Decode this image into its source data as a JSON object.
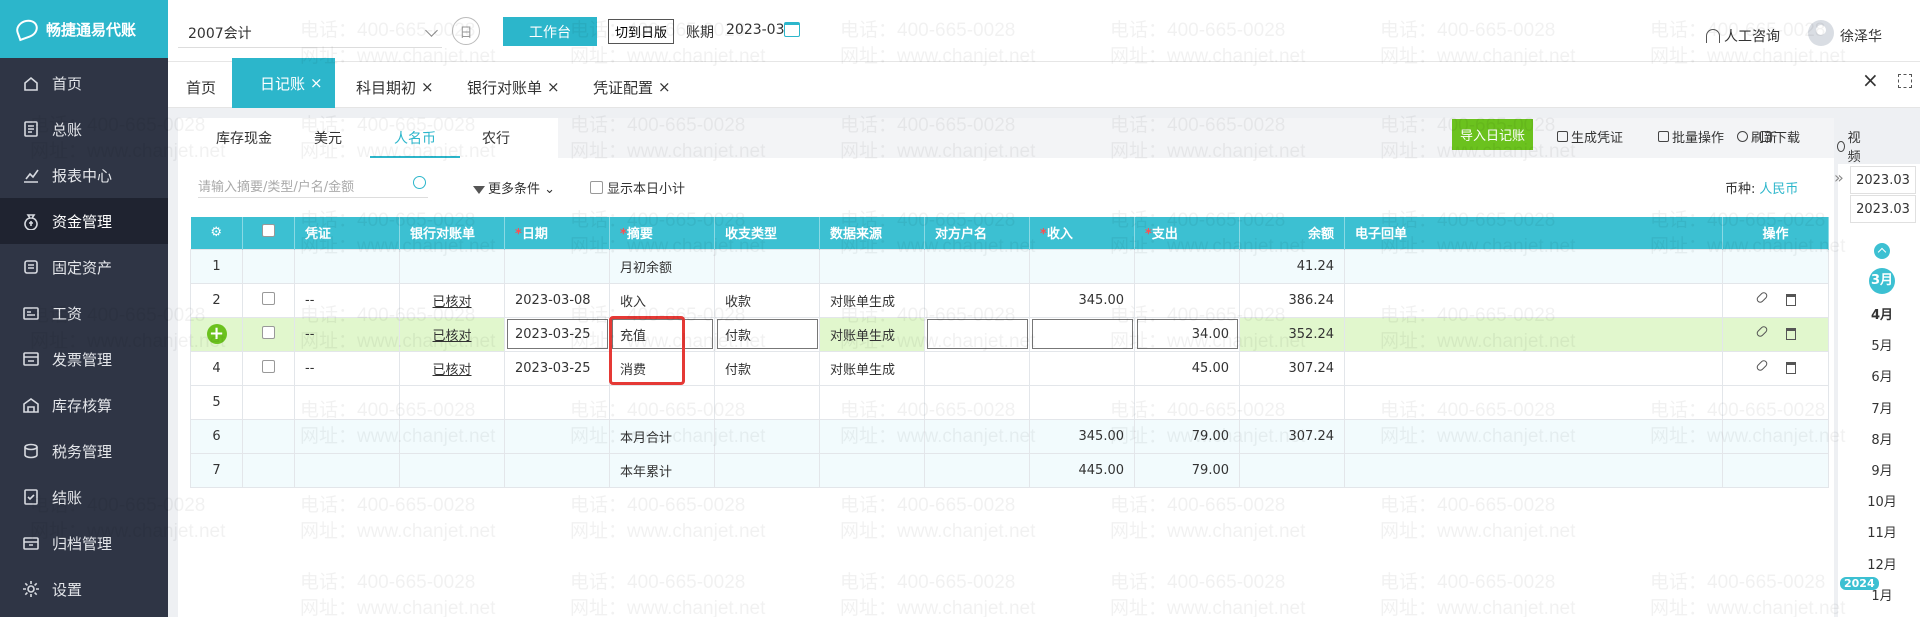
{
  "app": {
    "logo_text": "畅捷通易代账"
  },
  "sidebar": {
    "items": [
      {
        "label": "首页",
        "icon": "home-icon"
      },
      {
        "label": "总账",
        "icon": "ledger-icon"
      },
      {
        "label": "报表中心",
        "icon": "chart-icon"
      },
      {
        "label": "资金管理",
        "icon": "money-bag-icon",
        "active": true
      },
      {
        "label": "固定资产",
        "icon": "asset-icon"
      },
      {
        "label": "工资",
        "icon": "salary-icon"
      },
      {
        "label": "发票管理",
        "icon": "invoice-icon"
      },
      {
        "label": "库存核算",
        "icon": "warehouse-icon"
      },
      {
        "label": "税务管理",
        "icon": "tax-icon"
      },
      {
        "label": "结账",
        "icon": "checkout-icon"
      },
      {
        "label": "归档管理",
        "icon": "archive-icon"
      },
      {
        "label": "设置",
        "icon": "gear-icon"
      }
    ]
  },
  "header": {
    "book": "2007会计",
    "ri_icon_text": "日",
    "workbench": "工作台",
    "switch_journal": "切到日版",
    "period_label": "账期",
    "period_value": "2023-03",
    "support": "人工咨询",
    "user": "徐泽华"
  },
  "tabs": [
    {
      "label": "首页",
      "closable": false
    },
    {
      "label": "日记账",
      "closable": true,
      "active": true
    },
    {
      "label": "科目期初",
      "closable": true
    },
    {
      "label": "银行对账单",
      "closable": true
    },
    {
      "label": "凭证配置",
      "closable": true
    }
  ],
  "tab_close_symbol": "×",
  "subtabs": [
    "库存现金",
    "美元",
    "人名币",
    "农行"
  ],
  "actions": {
    "import": "导入日记账",
    "gen_voucher": "生成凭证",
    "batch": "批量操作",
    "download": "下载",
    "video": "视频",
    "refresh": "刷新"
  },
  "filter": {
    "search_placeholder": "请输入摘要/类型/户名/金额",
    "more": "更多条件",
    "show_daily_subtotal": "显示本日小计",
    "currency_label": "币种:",
    "currency_value": "人民币"
  },
  "table": {
    "columns": [
      "凭证",
      "银行对账单",
      "日期",
      "摘要",
      "收支类型",
      "数据来源",
      "对方户名",
      "收入",
      "支出",
      "余额",
      "电子回单",
      "操作"
    ],
    "required_mark": "*",
    "rows": [
      {
        "no": "1",
        "summary": "月初余额",
        "balance": "41.24",
        "style": "tint"
      },
      {
        "no": "2",
        "voucher": "--",
        "bank": "已核对",
        "date": "2023-03-08",
        "summary": "收入",
        "type": "收款",
        "source": "对账单生成",
        "income": "345.00",
        "balance": "386.24",
        "checkbox": true,
        "ops": true
      },
      {
        "no": "+",
        "voucher": "--",
        "bank": "已核对",
        "date": "2023-03-25",
        "summary": "充值",
        "type": "付款",
        "source": "对账单生成",
        "expense": "34.00",
        "balance": "352.24",
        "checkbox": true,
        "ops": true,
        "style": "hl"
      },
      {
        "no": "4",
        "voucher": "--",
        "bank": "已核对",
        "date": "2023-03-25",
        "summary": "消费",
        "type": "付款",
        "source": "对账单生成",
        "expense": "45.00",
        "balance": "307.24",
        "checkbox": true,
        "ops": true
      },
      {
        "no": "5"
      },
      {
        "no": "6",
        "summary": "本月合计",
        "income": "345.00",
        "expense": "79.00",
        "balance": "307.24",
        "style": "tint"
      },
      {
        "no": "7",
        "summary": "本年累计",
        "income": "445.00",
        "expense": "79.00",
        "style": "tint"
      }
    ]
  },
  "date_panel": {
    "top_dates": [
      "2023.03",
      "2023.03"
    ],
    "months": [
      "3月",
      "4月",
      "5月",
      "6月",
      "7月",
      "8月",
      "9月",
      "10月",
      "11月",
      "12月",
      "1月"
    ],
    "current_month": "3月",
    "year_badge": "2024"
  },
  "watermark": {
    "phone": "电话：400-665-0028",
    "site": "网址：www.chanjet.net"
  },
  "colors": {
    "accent": "#2cb6cb",
    "header": "#3cc0d2",
    "sidebar": "#2f3545",
    "green": "#6bc21e",
    "highlight_box": "#e53935"
  }
}
